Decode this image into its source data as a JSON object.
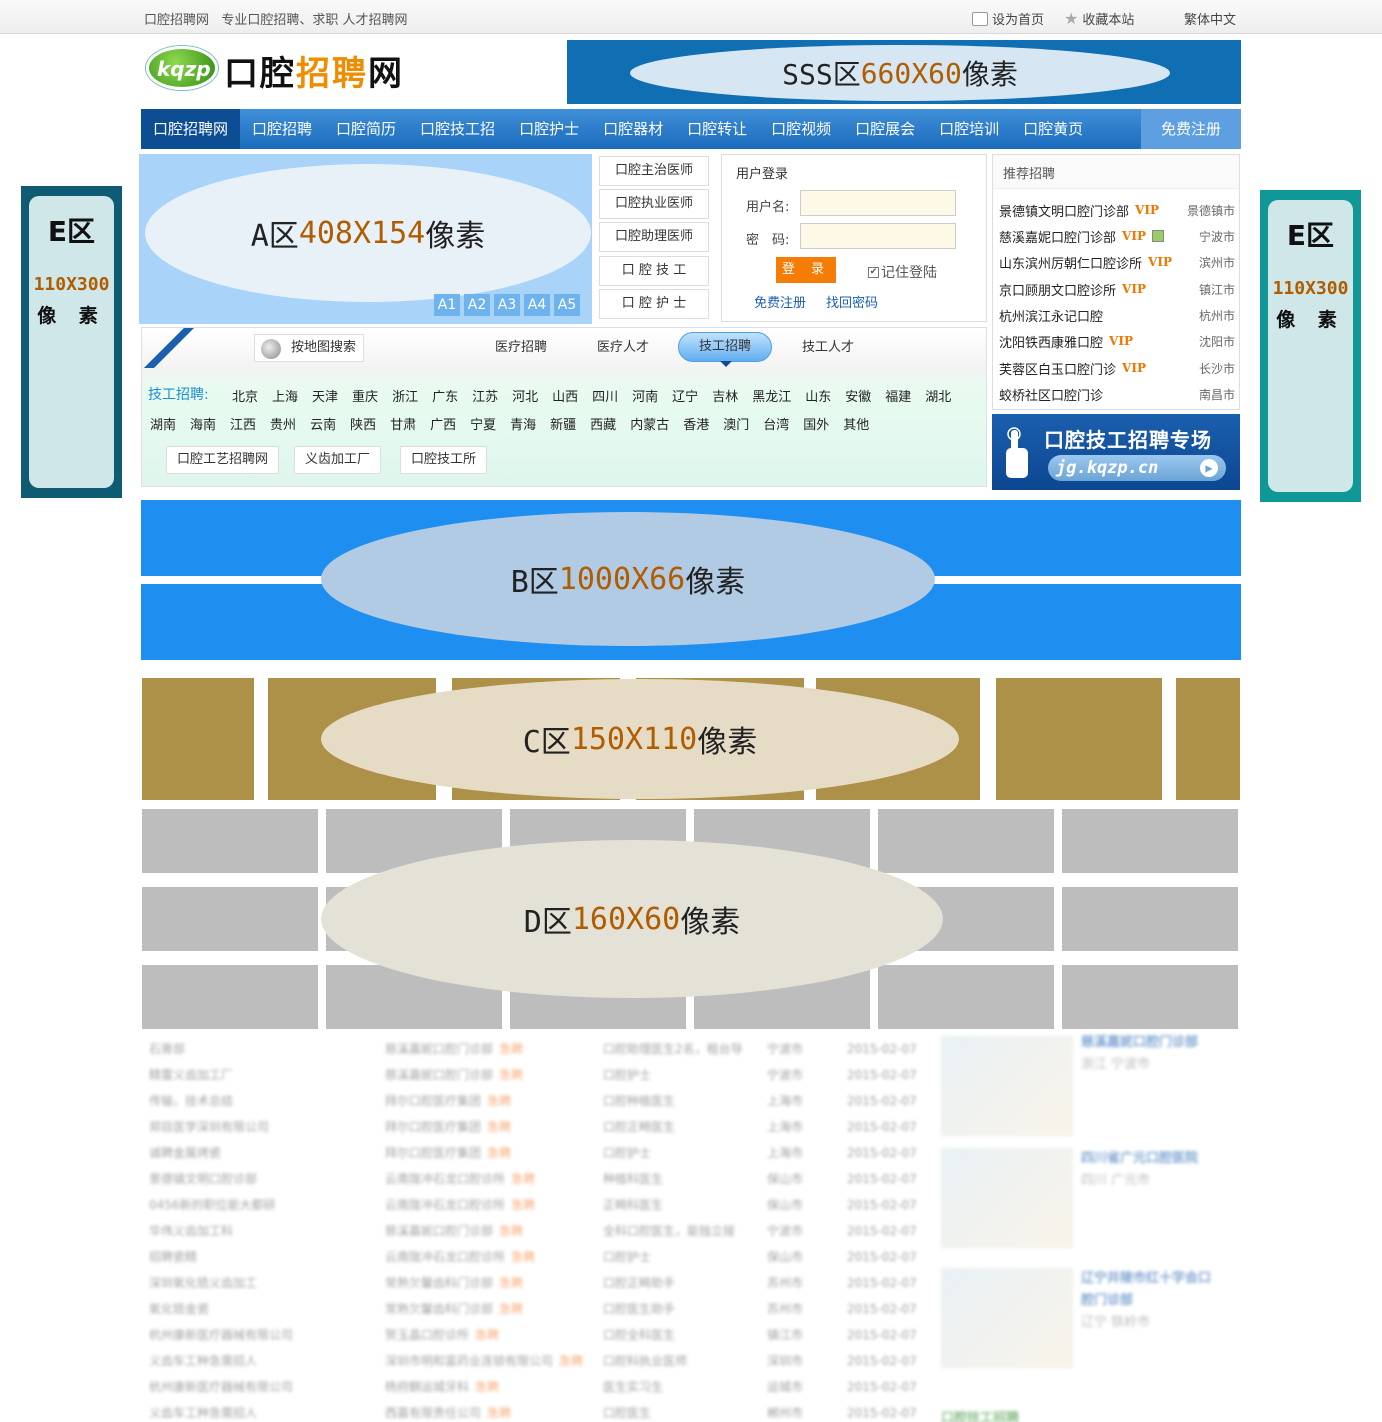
{
  "topbar": {
    "site": "口腔招聘网",
    "slogan": "专业口腔招聘、求职 人才招聘网",
    "set_home": "设为首页",
    "bookmark": "收藏本站",
    "traditional": "繁体中文"
  },
  "logo": {
    "badge": "kqzp",
    "text_black_1": "口腔",
    "text_orange": "招聘",
    "text_black_2": "网"
  },
  "ads": {
    "sss": {
      "name": "SSS区",
      "w": "660",
      "x": "X",
      "h": "60",
      "unit": "像素"
    },
    "a": {
      "name": "A区",
      "w": "408",
      "x": "X",
      "h": "154",
      "unit": "像素",
      "tabs": [
        "A1",
        "A2",
        "A3",
        "A4",
        "A5"
      ]
    },
    "b": {
      "name": "B区",
      "w": "1000",
      "x": "X",
      "h": "66",
      "unit": "像素"
    },
    "c": {
      "name": "C区",
      "w": "150",
      "x": "X",
      "h": "110",
      "unit": "像素"
    },
    "d": {
      "name": "D区",
      "w": "160",
      "x": "X",
      "h": "60",
      "unit": "像素"
    },
    "e_left": {
      "name": "E区",
      "size": "110X300",
      "unit": "像 素"
    },
    "e_right": {
      "name": "E区",
      "size": "110X300",
      "unit": "像 素"
    }
  },
  "nav": {
    "items": [
      "口腔招聘网",
      "口腔招聘",
      "口腔简历",
      "口腔技工招",
      "口腔护士",
      "口腔器材",
      "口腔转让",
      "口腔视频",
      "口腔展会",
      "口腔培训",
      "口腔黄页"
    ],
    "register": "免费注册"
  },
  "quick": [
    "口腔主治医师",
    "口腔执业医师",
    "口腔助理医师",
    "口 腔 技 工",
    "口 腔 护 士"
  ],
  "login": {
    "title": "用户登录",
    "username_label": "用户名:",
    "password_label": "密　码:",
    "submit": "登 录",
    "remember": "记住登陆",
    "register": "免费注册",
    "forgot": "找回密码"
  },
  "recommend": {
    "title": "推荐招聘",
    "items": [
      {
        "name": "景德镇文明口腔门诊部",
        "vip": "VIP",
        "city": "景德镇市"
      },
      {
        "name": "慈溪嘉妮口腔门诊部",
        "vip": "VIP",
        "city": "宁波市",
        "img": true
      },
      {
        "name": "山东滨州厉朝仁口腔诊所",
        "vip": "VIP",
        "city": "滨州市"
      },
      {
        "name": "京口顾朋文口腔诊所",
        "vip": "VIP",
        "city": "镇江市"
      },
      {
        "name": "杭州滨江永记口腔",
        "vip": "",
        "city": "杭州市"
      },
      {
        "name": "沈阳铁西康雅口腔",
        "vip": "VIP",
        "city": "沈阳市"
      },
      {
        "name": "芙蓉区白玉口腔门诊",
        "vip": "VIP",
        "city": "长沙市"
      },
      {
        "name": "蛟桥社区口腔门诊",
        "vip": "",
        "city": "南昌市"
      }
    ]
  },
  "jg": {
    "title": "口腔技工招聘专场",
    "url": "jg.kqzp.cn"
  },
  "search": {
    "map": "按地图搜索",
    "tabs": [
      "医疗招聘",
      "医疗人才",
      "技工招聘",
      "技工人才"
    ],
    "label": "技工招聘:",
    "row1": [
      "北京",
      "上海",
      "天津",
      "重庆",
      "浙江",
      "广东",
      "江苏",
      "河北",
      "山西",
      "四川",
      "河南",
      "辽宁",
      "吉林",
      "黑龙江",
      "山东",
      "安徽",
      "福建",
      "湖北"
    ],
    "row2": [
      "湖南",
      "海南",
      "江西",
      "贵州",
      "云南",
      "陕西",
      "甘肃",
      "广西",
      "宁夏",
      "青海",
      "新疆",
      "西藏",
      "内蒙古",
      "香港",
      "澳门",
      "台湾",
      "国外",
      "其他"
    ],
    "links": [
      "口腔工艺招聘网",
      "义齿加工厂",
      "口腔技工所"
    ]
  },
  "blurred": {
    "left": [
      "石膏部",
      "精雷义齿加工厂",
      "传输，技术总结",
      "郑目医学深圳有限公司",
      "诚聘金属烤瓷",
      "景德镇文明口腔诊部",
      "0456新的职位能大都研",
      "华伟义齿加工科",
      "招聘瓷精",
      "深圳氧化锆义齿加工",
      "氧化锆金瓷",
      "杭州康新医疗器械有限公司",
      "义齿车工种急需招人",
      "杭州康新医疗器械有限公司",
      "义齿车工种急需招人"
    ],
    "mid_names": [
      "慈溪嘉妮口腔门诊部",
      "慈溪嘉妮口腔门诊部",
      "拜尔口腔医疗集团",
      "拜尔口腔医疗集团",
      "拜尔口腔医疗集团",
      "云南陇冲石龙口腔诊所",
      "云南陇冲石龙口腔诊所",
      "慈溪嘉妮口腔门诊部",
      "云南陇冲石龙口腔诊所",
      "常熟欠馨齿科门诊部",
      "常熟欠馨齿科门诊部",
      "贺玉晶口腔诊所",
      "深圳市明和富药业连锁有限公司",
      "杨府麒运城牙科",
      "西嘉有限责任公司"
    ],
    "mid_tag": "急聘",
    "mid_jobs": [
      "口腔助理医生2名，租台导",
      "口腔护士",
      "口腔种植医生",
      "口腔正畸医生",
      "口腔护士",
      "种植科医生",
      "正畸科医生",
      "全科口腔医生，能独立接",
      "口腔护士",
      "口腔正畸助手",
      "口腔医生助手",
      "口腔全科医生",
      "口腔科执业医师",
      "医生实习生",
      "口腔医生"
    ],
    "mid_city": [
      "宁波市",
      "宁波市",
      "上海市",
      "上海市",
      "上海市",
      "保山市",
      "保山市",
      "宁波市",
      "保山市",
      "苏州市",
      "苏州市",
      "镇江市",
      "深圳市",
      "运城市",
      "郴州市"
    ],
    "mid_date": "2015-02-07",
    "right": [
      {
        "title": "慈溪嘉妮口腔门诊部",
        "area": "浙江 宁波市"
      },
      {
        "title": "四川省广元口腔医院",
        "area": "四川 广元市"
      },
      {
        "title": "辽宁井陵市红十字会口腔门诊部",
        "area": "辽宁 铁岭市"
      }
    ],
    "footer": "口腔技工招聘"
  }
}
